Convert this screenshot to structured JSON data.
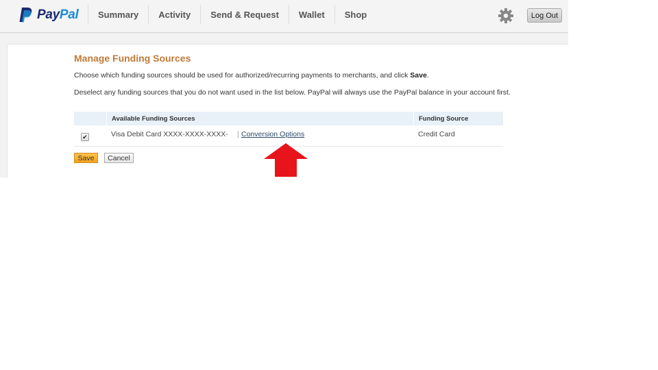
{
  "header": {
    "logo": {
      "pay": "Pay",
      "pal": "Pal"
    },
    "nav": [
      {
        "label": "Summary"
      },
      {
        "label": "Activity"
      },
      {
        "label": "Send & Request"
      },
      {
        "label": "Wallet"
      },
      {
        "label": "Shop"
      }
    ],
    "settings_icon": "gear-icon",
    "logout_label": "Log Out"
  },
  "main": {
    "title": "Manage Funding Sources",
    "intro": {
      "before": "Choose which funding sources should be used for authorized/recurring payments to merchants, and click ",
      "bold": "Save",
      "after": "."
    },
    "note": "Deselect any funding sources that you do not want used in the list below. PayPal will always use the PayPal balance in your account first.",
    "table": {
      "headers": [
        "",
        "Available Funding Sources",
        "Funding Source"
      ],
      "rows": [
        {
          "checked": true,
          "name": "Visa Debit Card XXXX-XXXX-XXXX-",
          "link": "Conversion Options",
          "type": "Credit Card"
        }
      ]
    },
    "buttons": {
      "save": "Save",
      "cancel": "Cancel"
    }
  },
  "annotation": {
    "arrow_color": "#e8141c",
    "points_to": "Conversion Options"
  },
  "colors": {
    "title": "#c07a36",
    "brand_dark": "#1a2a6c",
    "brand_light": "#1b8ad1",
    "save_button": "#f5a21e"
  }
}
